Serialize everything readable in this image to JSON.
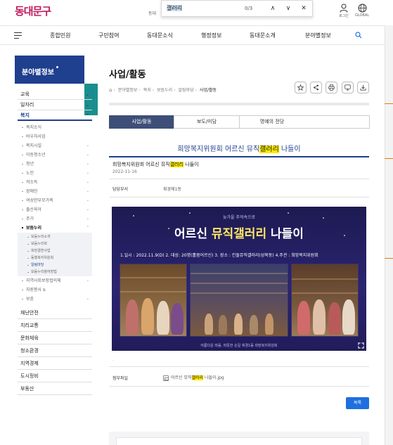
{
  "site": {
    "logo_text": "동대문구",
    "dong_hint": "동대"
  },
  "findbar": {
    "query": "갤러리",
    "count": "0/3",
    "up_glyph": "∧",
    "down_glyph": "∨",
    "close_glyph": "✕"
  },
  "utility": {
    "login_label": "로그인",
    "global_label": "GLOBAL"
  },
  "gnb": {
    "items": [
      "종합민원",
      "구민참여",
      "동대문소식",
      "행정정보",
      "동대문소개",
      "분야별정보"
    ]
  },
  "lnb": {
    "title": "분야별정보",
    "top_groups": [
      "교육",
      "일자리"
    ],
    "active_group": "복지",
    "subs": [
      "복지소식",
      "바우처사업",
      "복지시설",
      "아동청소년",
      "청년",
      "노인",
      "저소득",
      "장애인",
      "여성한부모가족",
      "출산육아",
      "주거",
      "보듬누리"
    ],
    "third_level": [
      "보듬누리소개",
      "보듬누리회",
      "희망결연사업",
      "동행복지위원회",
      "알림마당",
      "보듬누리참여방법"
    ],
    "active_third": "알림마당",
    "subs_after": [
      "지역사회보장협의체",
      "지원봉사",
      "보훈"
    ],
    "bottom_groups": [
      "재난안전",
      "치리교통",
      "문화체육",
      "청소환경",
      "지역경제",
      "도시정비",
      "부동산"
    ]
  },
  "page": {
    "title": "사업/활동",
    "breadcrumb": [
      "분야별정보",
      "복지",
      "보듬누리",
      "알림마당",
      "사업/활동"
    ]
  },
  "tabs": [
    "사업/활동",
    "보도/미담",
    "명예의 전당"
  ],
  "post": {
    "title_before": "희망복지위원회 어르신 뮤직",
    "title_highlight": "갤러리",
    "title_after": " 나들이",
    "sub_before": "희망복지위원회 어르신 뮤직",
    "sub_highlight": "갤러리",
    "sub_after": " 나들이",
    "date": "2022-11-16",
    "dept_label": "담당부서",
    "dept_value": "휘경제1동",
    "dot_line": ".",
    "attach_label": "첨부파일",
    "attach_before": "어르신 뮤직",
    "attach_highlight": "갤러리",
    "attach_after": " 나들이.jpg",
    "list_button": "목록"
  },
  "poster": {
    "subtitle": "늦가을 추억속으로",
    "main_before": "어르신 ",
    "main_highlight": "뮤직갤러리",
    "main_after": " 나들이",
    "info": "1.일시 : 2022.11.9(D)   2. 대상: 20명(홀몸어르신)   3. 장소 : 킨돌뮤직갤러리(성북동)   4.주관 : 희망복지위원회",
    "caption": "아름다운 마음, 따뜻한 손길  휘경1동 희망복지위원회"
  }
}
